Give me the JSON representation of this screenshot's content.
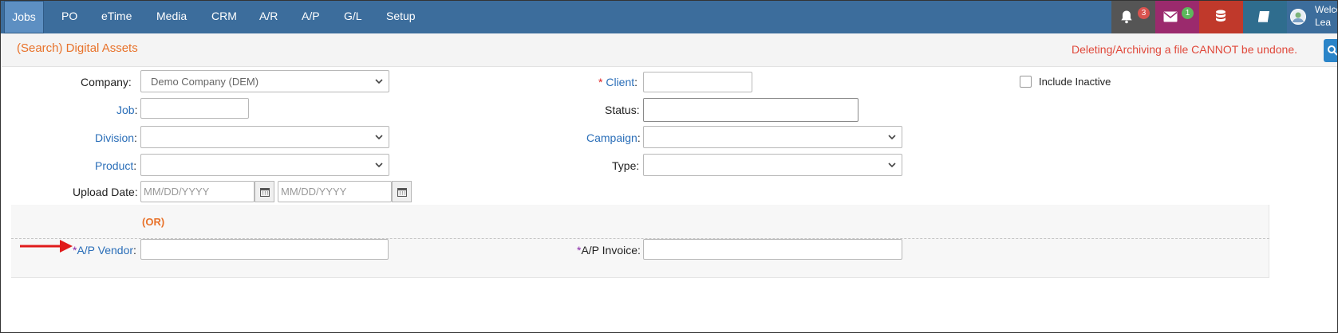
{
  "nav": {
    "items": [
      {
        "label": "Jobs",
        "active": true
      },
      {
        "label": "PO"
      },
      {
        "label": "eTime"
      },
      {
        "label": "Media"
      },
      {
        "label": "CRM"
      },
      {
        "label": "A/R"
      },
      {
        "label": "A/P"
      },
      {
        "label": "G/L"
      },
      {
        "label": "Setup"
      }
    ],
    "notifications_count": "3",
    "messages_count": "1",
    "welcome_text": "Welco",
    "user_name": "Lea",
    "colors": {
      "bar": "#3c6d9c",
      "bell_box": "#555555",
      "mail_box": "#9b2a6d",
      "db_box": "#c0392b",
      "book_box": "#2f6d8e"
    }
  },
  "header": {
    "title": "(Search) Digital Assets",
    "warning": "Deleting/Archiving a file CANNOT be undone."
  },
  "form": {
    "company_label": "Company:",
    "company_value": "Demo Company (DEM)",
    "job_label": "Job",
    "division_label": "Division",
    "product_label": "Product",
    "upload_date_label": "Upload Date:",
    "date_placeholder": "MM/DD/YYYY",
    "client_req": "*",
    "client_label": "Client",
    "status_label": "Status:",
    "campaign_label": "Campaign",
    "type_label": "Type:",
    "include_inactive_label": "Include Inactive",
    "or_text": "(OR)",
    "ap_vendor_req": "*",
    "ap_vendor_label": "A/P Vendor",
    "ap_invoice_req": "*",
    "ap_invoice_label": "A/P Invoice:",
    "colon": ":"
  }
}
